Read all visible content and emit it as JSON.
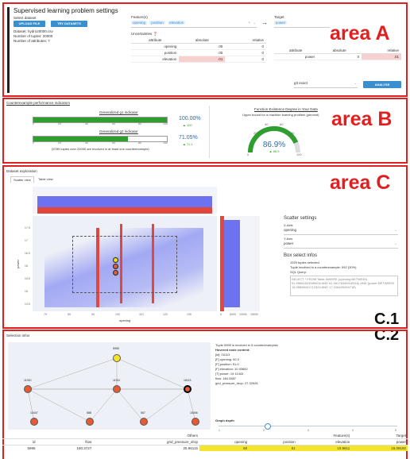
{
  "area_a": {
    "title": "Supervised learning problem settings",
    "select_dataset_label": "Select dataset",
    "upload_button": "UPLOAD FILE",
    "try_datasets_button": "TRY DATASETS",
    "dataset_info": [
      "Dataset: hydro20000.csv",
      "Number of tuples: 20000",
      "Number of attributes: 7"
    ],
    "features_label": "Feature(s)",
    "features": [
      "opening",
      "position",
      "elevation"
    ],
    "target_label": "Target",
    "target": "power",
    "uncertainties_label": "Uncertainties",
    "unc_headers": [
      "attribute",
      "absolute",
      "relative"
    ],
    "unc_rows": [
      [
        "opening",
        ".05",
        "0"
      ],
      [
        "position",
        ".05",
        "0"
      ],
      [
        "elevation",
        ".01",
        "0"
      ]
    ],
    "target_unc_headers": [
      "attribute",
      "absolute",
      "relative"
    ],
    "target_unc_rows": [
      [
        "power",
        "0",
        ".01"
      ]
    ],
    "method_select": "g3 exact",
    "analyse_button": "ANALYSE",
    "letter": "area A"
  },
  "area_b": {
    "title": "Counterexample performance indicators",
    "g1_title": "Generalized g1 indicator",
    "g1_percent": "100.00%",
    "g1_delta": "▲ 100",
    "g2_title": "Generalized g2 indicator",
    "g2_percent": "71.05%",
    "g2_delta": "▲ 71.1",
    "g2_note": "(5789 tuples over 20000 are involved in at least one counterexample)",
    "ticks": [
      "0",
      "20",
      "40",
      "60",
      "80",
      "100"
    ],
    "function_title": "Function Existence Degree in Your Data",
    "function_sub": "Upper bound for a machine learning problem (percent)",
    "gauge_value": "86.9%",
    "gauge_delta": "▲ 86.9",
    "gauge_ticks": [
      "20",
      "40",
      "60",
      "80",
      "0",
      "100"
    ],
    "letter": "area B"
  },
  "area_c": {
    "title": "Dataset exploration",
    "tabs": [
      "Scatter view",
      "Table view"
    ],
    "y_axis_label": "power",
    "x_axis_label": "opening",
    "y_ticks": [
      "17.5",
      "17",
      "16.5",
      "16",
      "15.5",
      "15",
      "14.5"
    ],
    "x_ticks": [
      "70",
      "80",
      "90",
      "100",
      "110",
      "120",
      "130"
    ],
    "side_ticks": [
      "0",
      "5000",
      "10000",
      "15000"
    ],
    "settings_title": "Scatter settings",
    "xaxis_label": "X-Axis",
    "xaxis_value": "opening",
    "yaxis_label": "Y-Axis",
    "yaxis_value": "power",
    "box_title": "Box select infos",
    "box_items": [
      "1929 tuples selected.",
      "Tuple involved in a counterexample: 592 (30%)",
      "SQL Query:"
    ],
    "sql_text": "SELECT * FROM Table WHERE (opening BETWEEN 91.99681624589006 AND 61.06176445916316) AND (power BETWEEN 15.35898441712324 AND 17.316426434718)",
    "letter": "area C",
    "c1": "C.1",
    "c2": "C.2"
  },
  "selection": {
    "title": "Selection infos",
    "involved": "Tuple 5995 is involved in 5 counterexamples",
    "hovered_title": "Hovered node content:",
    "hovered_lines": [
      "[id]: 16113",
      "[F] opening: 60.0",
      "[F] position: 51.0",
      "[F] elevation: 10.93682",
      "[T] power: 19.11443",
      "flow: 184.0887",
      "grid_pressure_drop: 27.32926"
    ],
    "nodes": [
      "5995",
      "11910",
      "11911",
      "16113",
      "13447",
      "588",
      "567",
      "15306"
    ],
    "graph_depth": "Graph depth",
    "depth_ticks": [
      "1",
      "2",
      "3",
      "4",
      "5"
    ],
    "table_group": [
      "Others",
      "Feature(s)",
      "Target"
    ],
    "table_headers": [
      "id",
      "flow",
      "grid_pressure_drop",
      "opening",
      "position",
      "elevation",
      "power"
    ],
    "table_row": [
      "5995",
      "180.3727",
      "25.96115",
      "60",
      "51",
      "10.9611",
      "16.09192"
    ]
  }
}
